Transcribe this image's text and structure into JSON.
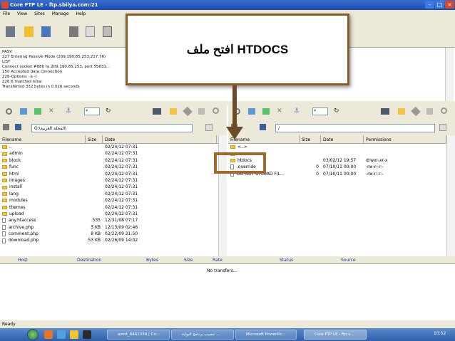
{
  "window": {
    "title": "Core FTP LE - ftp.sbilya.com:21"
  },
  "menu": [
    "File",
    "View",
    "Sites",
    "Manage",
    "Help"
  ],
  "log": [
    "PASV",
    "227 Entering Passive Mode (209,190,85,253,217,76)",
    "LIST",
    "Connect socket #880 to 209.190.85.253, port 55631...",
    "150 Accepted data connection",
    "226-Options: -a -l",
    "226 6 matches total",
    "Transferred 332 bytes in 0.016 seconds"
  ],
  "overlay": {
    "text": "افتح ملف  HTDOCS"
  },
  "local": {
    "path": "G:\\المجلة العربية\\",
    "headers": {
      "name": "Filename",
      "size": "Size",
      "date": "Date"
    },
    "rows": [
      {
        "name": "..",
        "type": "folder",
        "size": "",
        "date": "02/24/12  07:31"
      },
      {
        "name": "admin",
        "type": "folder",
        "size": "",
        "date": "02/24/12  07:31"
      },
      {
        "name": "block",
        "type": "folder",
        "size": "",
        "date": "02/24/12  07:31"
      },
      {
        "name": "func",
        "type": "folder",
        "size": "",
        "date": "02/24/12  07:31"
      },
      {
        "name": "html",
        "type": "folder",
        "size": "",
        "date": "02/24/12  07:31"
      },
      {
        "name": "images",
        "type": "folder",
        "size": "",
        "date": "02/24/12  07:31"
      },
      {
        "name": "install",
        "type": "folder",
        "size": "",
        "date": "02/24/12  07:31"
      },
      {
        "name": "lang",
        "type": "folder",
        "size": "",
        "date": "02/24/12  07:31"
      },
      {
        "name": "modules",
        "type": "folder",
        "size": "",
        "date": "02/24/12  07:31"
      },
      {
        "name": "themes",
        "type": "folder",
        "size": "",
        "date": "02/24/12  07:31"
      },
      {
        "name": "upload",
        "type": "folder",
        "size": "",
        "date": "02/24/12  07:31"
      },
      {
        "name": "any.htaccess",
        "type": "file",
        "size": "535",
        "date": "12/31/08  07:17"
      },
      {
        "name": "archive.php",
        "type": "file",
        "size": "5 KB",
        "date": "12/13/09  02:46"
      },
      {
        "name": "comment.php",
        "type": "file",
        "size": "8 KB",
        "date": "02/22/09  21:50"
      },
      {
        "name": "download.php",
        "type": "file",
        "size": "53 KB",
        "date": "02/26/09  14:02"
      }
    ]
  },
  "remote": {
    "path": "/",
    "headers": {
      "name": "Filename",
      "size": "Size",
      "date": "Date",
      "perm": "Permissions"
    },
    "rows": [
      {
        "name": "<..>",
        "type": "folder",
        "size": "",
        "date": "",
        "perm": ""
      },
      {
        "name": "..",
        "type": "folder",
        "size": "",
        "date": "",
        "perm": ""
      },
      {
        "name": "htdocs",
        "type": "folder",
        "size": "",
        "date": "03/02/12  19:57",
        "perm": "drwxr-xr-x"
      },
      {
        "name": ".override",
        "type": "file",
        "size": "0",
        "date": "07/10/11  00:00",
        "perm": "-rw-r--r--"
      },
      {
        "name": "DO NOT UPLOAD FIL...",
        "type": "file",
        "size": "0",
        "date": "07/10/11  00:00",
        "perm": "-rw-r--r--"
      }
    ]
  },
  "transfers": {
    "headers": [
      "Host",
      "Destination",
      "Bytes",
      "Size",
      "Rate",
      "Status",
      "Source"
    ],
    "empty": "No transfers..."
  },
  "status": "Ready",
  "taskbar": {
    "items": [
      "azert_8461334 | Co...",
      "تنصيب برنامج البوابة ...",
      "Microsoft PowerPo...",
      "Core FTP LE - ftp.s..."
    ],
    "clock": "10:52"
  }
}
